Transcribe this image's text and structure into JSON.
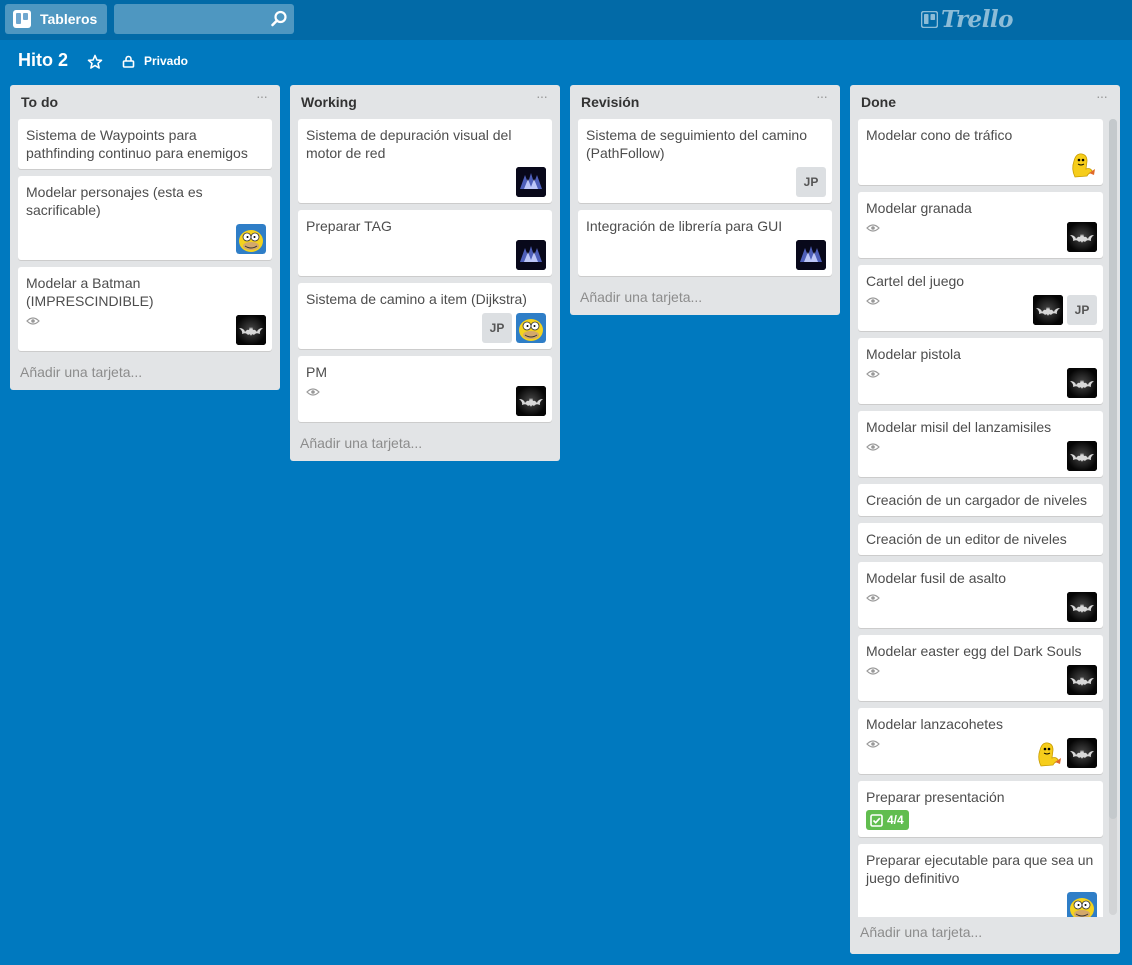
{
  "header": {
    "boards_label": "Tableros",
    "search_value": "",
    "logo_text": "Trello"
  },
  "board": {
    "title": "Hito 2",
    "privacy": "Privado"
  },
  "add_card_label": "Añadir una tarjeta...",
  "lists": [
    {
      "title": "To do",
      "cards": [
        {
          "title": "Sistema de Waypoints para pathfinding continuo para enemigos"
        },
        {
          "title": "Modelar personajes (esta es sacrificable)",
          "members": [
            "homer"
          ]
        },
        {
          "title": "Modelar a Batman (IMPRESCINDIBLE)",
          "watched": true,
          "members": [
            "batman"
          ]
        }
      ]
    },
    {
      "title": "Working",
      "cards": [
        {
          "title": "Sistema de depuración visual del motor de red",
          "members": [
            "batman-blue"
          ]
        },
        {
          "title": "Preparar TAG",
          "members": [
            "batman-blue"
          ]
        },
        {
          "title": "Sistema de camino a item (Dijkstra)",
          "members": [
            "JP",
            "homer"
          ]
        },
        {
          "title": "PM",
          "watched": true,
          "members": [
            "batman"
          ]
        }
      ]
    },
    {
      "title": "Revisión",
      "cards": [
        {
          "title": "Sistema de seguimiento del camino (PathFollow)",
          "members": [
            "JP"
          ]
        },
        {
          "title": "Integración de librería para GUI",
          "members": [
            "batman-blue"
          ]
        }
      ]
    },
    {
      "title": "Done",
      "cards": [
        {
          "title": "Modelar cono de tráfico",
          "members": [
            "yellow"
          ]
        },
        {
          "title": "Modelar granada",
          "watched": true,
          "members": [
            "batman"
          ]
        },
        {
          "title": "Cartel del juego",
          "watched": true,
          "members": [
            "batman",
            "JP"
          ]
        },
        {
          "title": "Modelar pistola",
          "watched": true,
          "members": [
            "batman"
          ]
        },
        {
          "title": "Modelar misil del lanzamisiles",
          "watched": true,
          "members": [
            "batman"
          ]
        },
        {
          "title": "Creación de un cargador de niveles"
        },
        {
          "title": "Creación de un editor de niveles"
        },
        {
          "title": "Modelar fusil de asalto",
          "watched": true,
          "members": [
            "batman"
          ]
        },
        {
          "title": "Modelar easter egg del Dark Souls",
          "watched": true,
          "members": [
            "batman"
          ]
        },
        {
          "title": "Modelar lanzacohetes",
          "watched": true,
          "members": [
            "yellow",
            "batman"
          ]
        },
        {
          "title": "Preparar presentación",
          "checklist": "4/4"
        },
        {
          "title": "Preparar ejecutable para que sea un juego definitivo",
          "members": [
            "homer"
          ]
        }
      ]
    }
  ],
  "colors": {
    "board_bg": "#0079bf",
    "header_bg": "#026aa7",
    "list_bg": "#e2e4e6",
    "checklist_green": "#61bd4f"
  }
}
